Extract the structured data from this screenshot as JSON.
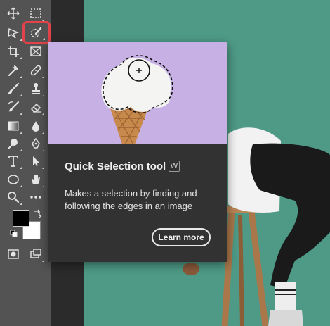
{
  "toolbar": {
    "tools": [
      {
        "name": "move-tool",
        "icon": "move-icon"
      },
      {
        "name": "marquee-tool",
        "icon": "marquee-icon"
      },
      {
        "name": "lasso-tool",
        "icon": "lasso-icon"
      },
      {
        "name": "quick-selection-tool",
        "icon": "quick-selection-icon",
        "highlighted": true
      },
      {
        "name": "crop-tool",
        "icon": "crop-icon"
      },
      {
        "name": "frame-tool",
        "icon": "frame-icon"
      },
      {
        "name": "eyedropper-tool",
        "icon": "eyedropper-icon"
      },
      {
        "name": "spot-healing-tool",
        "icon": "bandage-icon"
      },
      {
        "name": "brush-tool",
        "icon": "brush-icon"
      },
      {
        "name": "clone-stamp-tool",
        "icon": "stamp-icon"
      },
      {
        "name": "history-brush-tool",
        "icon": "history-brush-icon"
      },
      {
        "name": "eraser-tool",
        "icon": "eraser-icon"
      },
      {
        "name": "gradient-tool",
        "icon": "gradient-icon"
      },
      {
        "name": "blur-tool",
        "icon": "drop-icon"
      },
      {
        "name": "dodge-tool",
        "icon": "dodge-icon"
      },
      {
        "name": "pen-tool",
        "icon": "pen-icon"
      },
      {
        "name": "type-tool",
        "icon": "type-icon"
      },
      {
        "name": "path-selection-tool",
        "icon": "arrow-icon"
      },
      {
        "name": "shape-tool",
        "icon": "ellipse-icon"
      },
      {
        "name": "hand-tool",
        "icon": "hand-icon"
      },
      {
        "name": "zoom-tool",
        "icon": "zoom-icon"
      },
      {
        "name": "more-tools",
        "icon": "ellipsis-icon"
      }
    ],
    "foreground_color": "#000000",
    "background_color": "#ffffff",
    "highlight_color": "#e2424a"
  },
  "tooltip": {
    "title": "Quick Selection tool",
    "shortcut": "W",
    "description": "Makes a selection by finding and following the edges in an image",
    "learn_more": "Learn more",
    "preview_bg": "#c7b1e4"
  },
  "canvas": {
    "background": "#4e9a86"
  }
}
